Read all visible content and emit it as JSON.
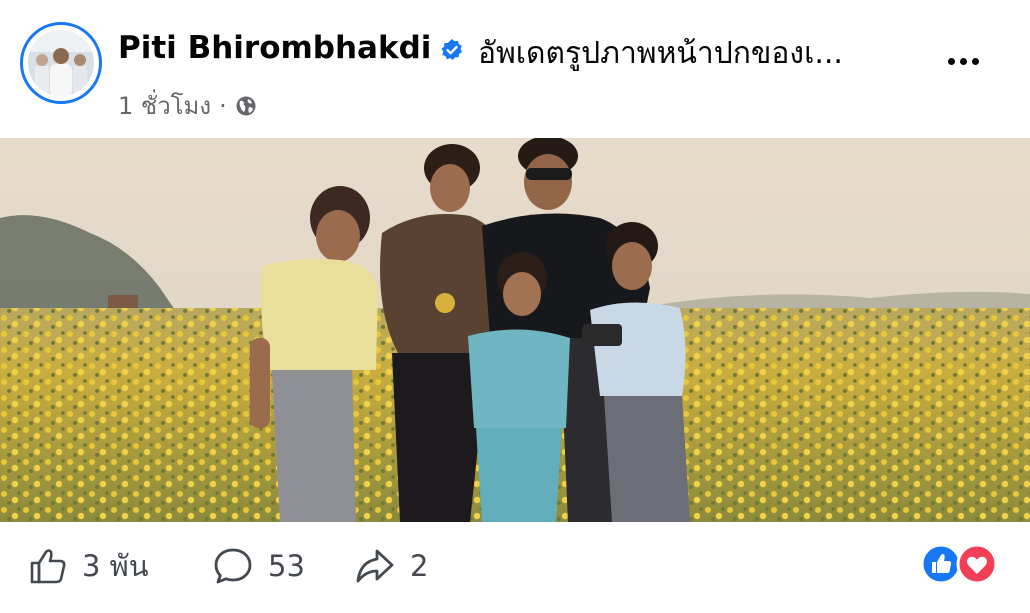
{
  "post": {
    "author": "Piti Bhirombhakdi",
    "status": "อัพเดตรูปภาพหน้าปกของเ...",
    "time": "1 ชั่วโมง",
    "separator": "·",
    "privacy_icon": "globe-icon",
    "verified_icon": "verified-badge-icon"
  },
  "actions": {
    "likes": "3 พัน",
    "comments": "53",
    "shares": "2"
  },
  "colors": {
    "brand_blue": "#1877f2",
    "love_red": "#f33e58",
    "secondary_text": "#65676b"
  }
}
